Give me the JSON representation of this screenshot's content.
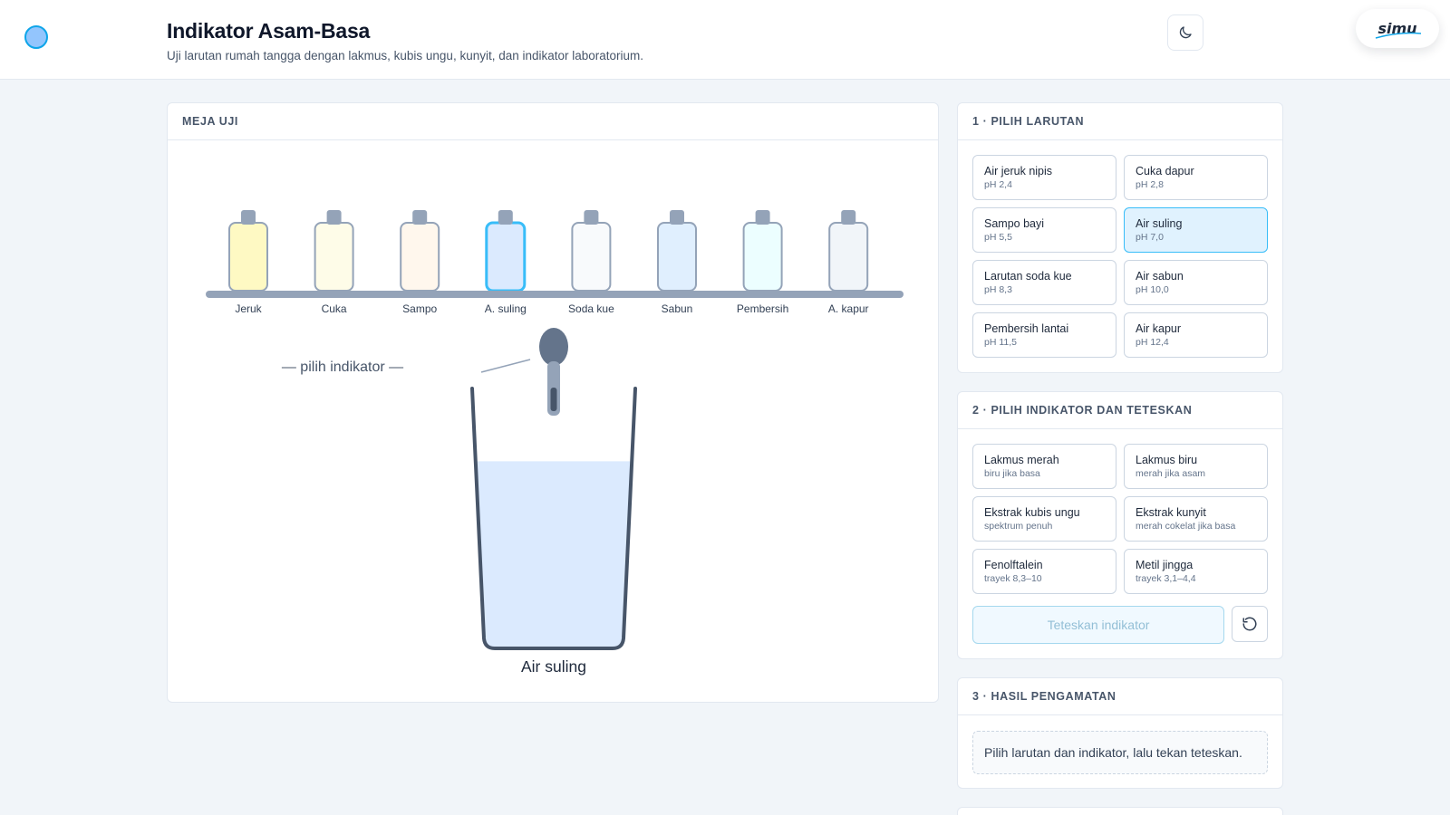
{
  "header": {
    "title": "Indikator Asam-Basa",
    "subtitle": "Uji larutan rumah tangga dengan lakmus, kubis ungu, kunyit, dan indikator laboratorium.",
    "brand": "simu",
    "theme_icon": "moon-icon"
  },
  "bench": {
    "heading": "MEJA UJI",
    "bottles": [
      {
        "label": "Jeruk",
        "fill": "#fef9c3"
      },
      {
        "label": "Cuka",
        "fill": "#fefce8"
      },
      {
        "label": "Sampo",
        "fill": "#fff7ed"
      },
      {
        "label": "A. suling",
        "fill": "#dbeafe",
        "selected": true
      },
      {
        "label": "Soda kue",
        "fill": "#f8fafc"
      },
      {
        "label": "Sabun",
        "fill": "#e0effe"
      },
      {
        "label": "Pembersih",
        "fill": "#ecfeff"
      },
      {
        "label": "A. kapur",
        "fill": "#f1f5f9"
      }
    ],
    "indicator_hint": "— pilih indikator —",
    "beaker_label": "Air suling",
    "beaker_fill_fraction": 0.72,
    "liquid_color": "#dbeafe"
  },
  "step1": {
    "heading": "1 · PILIH LARUTAN",
    "options": [
      {
        "label": "Air jeruk nipis",
        "sub": "pH 2,4"
      },
      {
        "label": "Cuka dapur",
        "sub": "pH 2,8"
      },
      {
        "label": "Sampo bayi",
        "sub": "pH 5,5"
      },
      {
        "label": "Air suling",
        "sub": "pH 7,0",
        "selected": true
      },
      {
        "label": "Larutan soda kue",
        "sub": "pH 8,3"
      },
      {
        "label": "Air sabun",
        "sub": "pH 10,0"
      },
      {
        "label": "Pembersih lantai",
        "sub": "pH 11,5"
      },
      {
        "label": "Air kapur",
        "sub": "pH 12,4"
      }
    ]
  },
  "step2": {
    "heading": "2 · PILIH INDIKATOR DAN TETESKAN",
    "options": [
      {
        "label": "Lakmus merah",
        "sub": "biru jika basa"
      },
      {
        "label": "Lakmus biru",
        "sub": "merah jika asam"
      },
      {
        "label": "Ekstrak kubis ungu",
        "sub": "spektrum penuh"
      },
      {
        "label": "Ekstrak kunyit",
        "sub": "merah cokelat jika basa"
      },
      {
        "label": "Fenolftalein",
        "sub": "trayek 8,3–10"
      },
      {
        "label": "Metil jingga",
        "sub": "trayek 3,1–4,4"
      }
    ],
    "drip_button": "Teteskan indikator",
    "reset_icon": "reset-icon"
  },
  "step3": {
    "heading": "3 · HASIL PENGAMATAN",
    "message": "Pilih larutan dan indikator, lalu tekan teteskan."
  },
  "colors": {
    "accent": "#38bdf8",
    "selected_bg": "#e0f2fe",
    "beaker_stroke": "#475569",
    "shelf": "#94a3b8"
  }
}
